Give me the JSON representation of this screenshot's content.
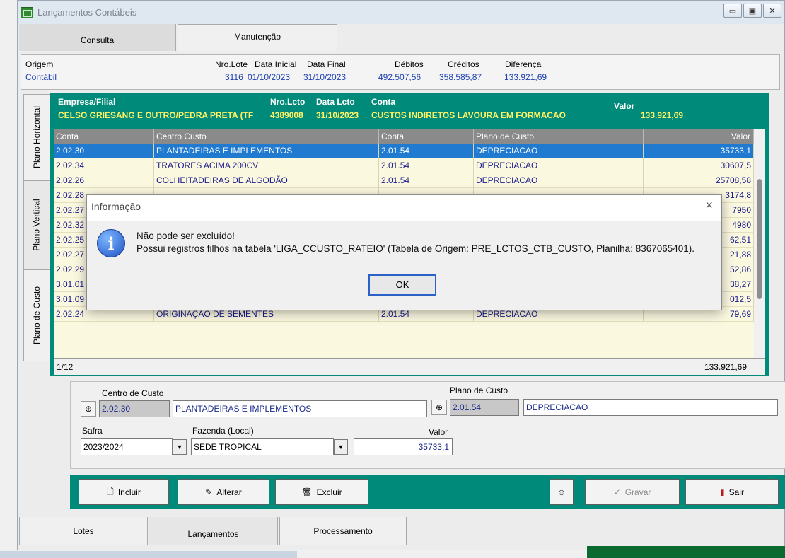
{
  "window": {
    "title": "Lançamentos Contábeis"
  },
  "top_tabs": [
    "Consulta",
    "Manutenção"
  ],
  "origem": {
    "labels": {
      "origem": "Origem",
      "lote": "Nro.Lote",
      "data_inicial": "Data Inicial",
      "data_final": "Data Final",
      "debitos": "Débitos",
      "creditos": "Créditos",
      "diferenca": "Diferença"
    },
    "values": {
      "origem": "Contábil",
      "lote": "3116",
      "data_inicial": "01/10/2023",
      "data_final": "31/10/2023",
      "debitos": "492.507,56",
      "creditos": "358.585,87",
      "diferenca": "133.921,69"
    }
  },
  "side_tabs": [
    "Plano Horizontal",
    "Plano Vertical",
    "Plano de Custo"
  ],
  "header": {
    "labels": {
      "empresa": "Empresa/Filial",
      "lcto": "Nro.Lcto",
      "data": "Data Lcto",
      "conta": "Conta",
      "valor": "Valor"
    },
    "values": {
      "empresa": "CELSO GRIESANG E OUTRO/PEDRA PRETA (TF",
      "lcto": "4389008",
      "data": "31/10/2023",
      "conta": "CUSTOS INDIRETOS LAVOURA EM FORMACAO",
      "valor": "133.921,69"
    }
  },
  "grid": {
    "columns": [
      "Conta",
      "Centro Custo",
      "Conta",
      "Plano de Custo",
      "Valor"
    ],
    "rows": [
      [
        "2.02.30",
        "PLANTADEIRAS E IMPLEMENTOS",
        "2.01.54",
        "DEPRECIACAO",
        "35733,1"
      ],
      [
        "2.02.34",
        "TRATORES ACIMA 200CV",
        "2.01.54",
        "DEPRECIACAO",
        "30607,5"
      ],
      [
        "2.02.26",
        "COLHEITADEIRAS DE ALGODÃO",
        "2.01.54",
        "DEPRECIACAO",
        "25708,58"
      ],
      [
        "2.02.28",
        "",
        "",
        "",
        "3174,8"
      ],
      [
        "2.02.27",
        "",
        "",
        "",
        "7950"
      ],
      [
        "2.02.32",
        "",
        "",
        "",
        "4980"
      ],
      [
        "2.02.25",
        "",
        "",
        "",
        "62,51"
      ],
      [
        "2.02.27",
        "",
        "",
        "",
        "21,88"
      ],
      [
        "2.02.29",
        "",
        "",
        "",
        "52,86"
      ],
      [
        "3.01.01",
        "",
        "",
        "",
        "38,27"
      ],
      [
        "3.01.09",
        "",
        "",
        "",
        "012,5"
      ],
      [
        "2.02.24",
        "ORIGINAÇAO DE SEMENTES",
        "2.01.54",
        "DEPRECIACAO",
        "79,69"
      ]
    ],
    "footer_count": "1/12",
    "footer_total": "133.921,69"
  },
  "edit": {
    "centro_label": "Centro de Custo",
    "centro_code": "2.02.30",
    "centro_name": "PLANTADEIRAS E IMPLEMENTOS",
    "plano_label": "Plano de Custo",
    "plano_code": "2.01.54",
    "plano_name": "DEPRECIACAO",
    "safra_label": "Safra",
    "safra_value": "2023/2024",
    "fazenda_label": "Fazenda (Local)",
    "fazenda_value": "SEDE TROPICAL",
    "valor_label": "Valor",
    "valor_value": "35733,1"
  },
  "buttons": {
    "incluir": "Incluir",
    "alterar": "Alterar",
    "excluir": "Excluir",
    "gravar": "Gravar",
    "sair": "Sair"
  },
  "bottom_tabs": [
    "Lotes",
    "Lançamentos",
    "Processamento"
  ],
  "dialog": {
    "title": "Informação",
    "line1": "Não pode ser excluído!",
    "line2": "Possui registros filhos na tabela 'LIGA_CCUSTO_RATEIO' (Tabela de Origem: PRE_LCTOS_CTB_CUSTO, Planilha: 8367065401).",
    "ok": "OK",
    "close_glyph": "×",
    "icon_glyph": "i"
  }
}
